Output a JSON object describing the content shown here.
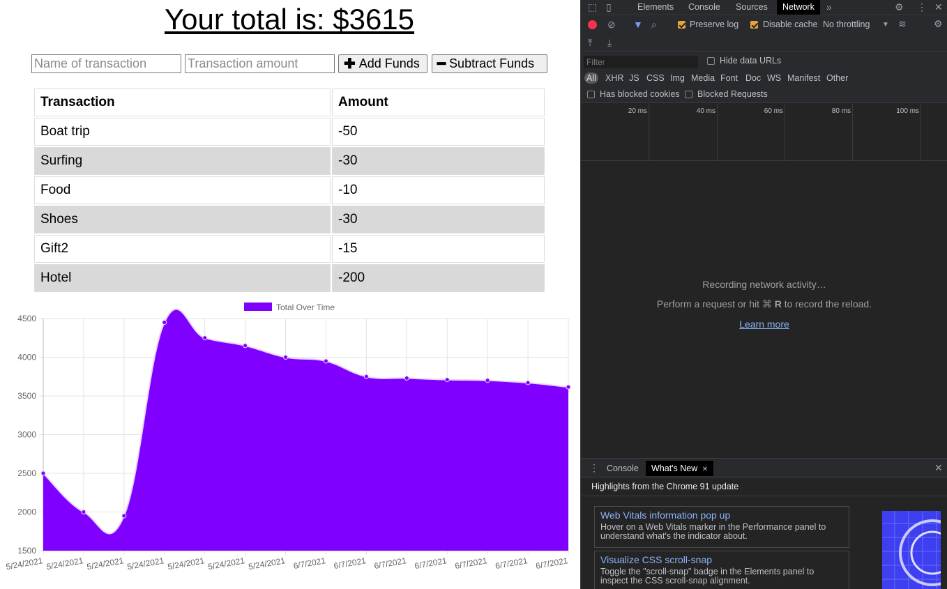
{
  "app": {
    "total_title": "Your total is: $3615",
    "name_placeholder": "Name of transaction",
    "amount_placeholder": "Transaction amount",
    "add_label": "Add Funds",
    "subtract_label": "Subtract Funds",
    "add_icon": "plus-icon",
    "subtract_icon": "minus-icon",
    "table": {
      "headers": [
        "Transaction",
        "Amount"
      ],
      "rows": [
        {
          "name": "Boat trip",
          "amount": "-50"
        },
        {
          "name": "Surfing",
          "amount": "-30"
        },
        {
          "name": "Food",
          "amount": "-10"
        },
        {
          "name": "Shoes",
          "amount": "-30"
        },
        {
          "name": "Gift2",
          "amount": "-15"
        },
        {
          "name": "Hotel",
          "amount": "-200"
        }
      ]
    }
  },
  "chart_data": {
    "type": "area",
    "title": "",
    "xlabel": "",
    "ylabel": "",
    "x": [
      "5/24/2021",
      "5/24/2021",
      "5/24/2021",
      "5/24/2021",
      "5/24/2021",
      "5/24/2021",
      "5/24/2021",
      "6/7/2021",
      "6/7/2021",
      "6/7/2021",
      "6/7/2021",
      "6/7/2021",
      "6/7/2021",
      "6/7/2021"
    ],
    "series": [
      {
        "name": "Total Over Time",
        "color": "#7f00ff",
        "values": [
          2500,
          2000,
          1950,
          4450,
          4250,
          4150,
          4000,
          3950,
          3750,
          3730,
          3710,
          3700,
          3670,
          3615
        ]
      }
    ],
    "ylim": [
      1500,
      4500
    ],
    "yticks": [
      1500,
      2000,
      2500,
      3000,
      3500,
      4000,
      4500
    ],
    "grid": true,
    "legend": "top-center"
  },
  "devtools": {
    "tabs": [
      "Elements",
      "Console",
      "Sources",
      "Network"
    ],
    "active_tab": "Network",
    "more_tabs_icon": "double-chevron-right-icon",
    "toolbar": {
      "preserve_log": "Preserve log",
      "preserve_log_checked": true,
      "disable_cache": "Disable cache",
      "disable_cache_checked": true,
      "throttling": "No throttling"
    },
    "filter_placeholder": "Filter",
    "hide_data_urls": "Hide data URLs",
    "types": [
      "All",
      "XHR",
      "JS",
      "CSS",
      "Img",
      "Media",
      "Font",
      "Doc",
      "WS",
      "Manifest",
      "Other"
    ],
    "has_blocked_cookies": "Has blocked cookies",
    "blocked_requests": "Blocked Requests",
    "timeline_ticks": [
      "20 ms",
      "40 ms",
      "60 ms",
      "80 ms",
      "100 ms"
    ],
    "empty": {
      "line1": "Recording network activity…",
      "line2_pre": "Perform a request or hit ⌘ ",
      "line2_key": "R",
      "line2_post": " to record the reload.",
      "learn_more": "Learn more"
    },
    "drawer": {
      "tabs": [
        "Console",
        "What's New"
      ],
      "active": "What's New",
      "highlights": "Highlights from the Chrome 91 update",
      "cards": [
        {
          "title": "Web Vitals information pop up",
          "desc": "Hover on a Web Vitals marker in the Performance panel to understand what's the indicator about."
        },
        {
          "title": "Visualize CSS scroll-snap",
          "desc": "Toggle the \"scroll-snap\" badge in the Elements panel to inspect the CSS scroll-snap alignment."
        }
      ]
    }
  }
}
